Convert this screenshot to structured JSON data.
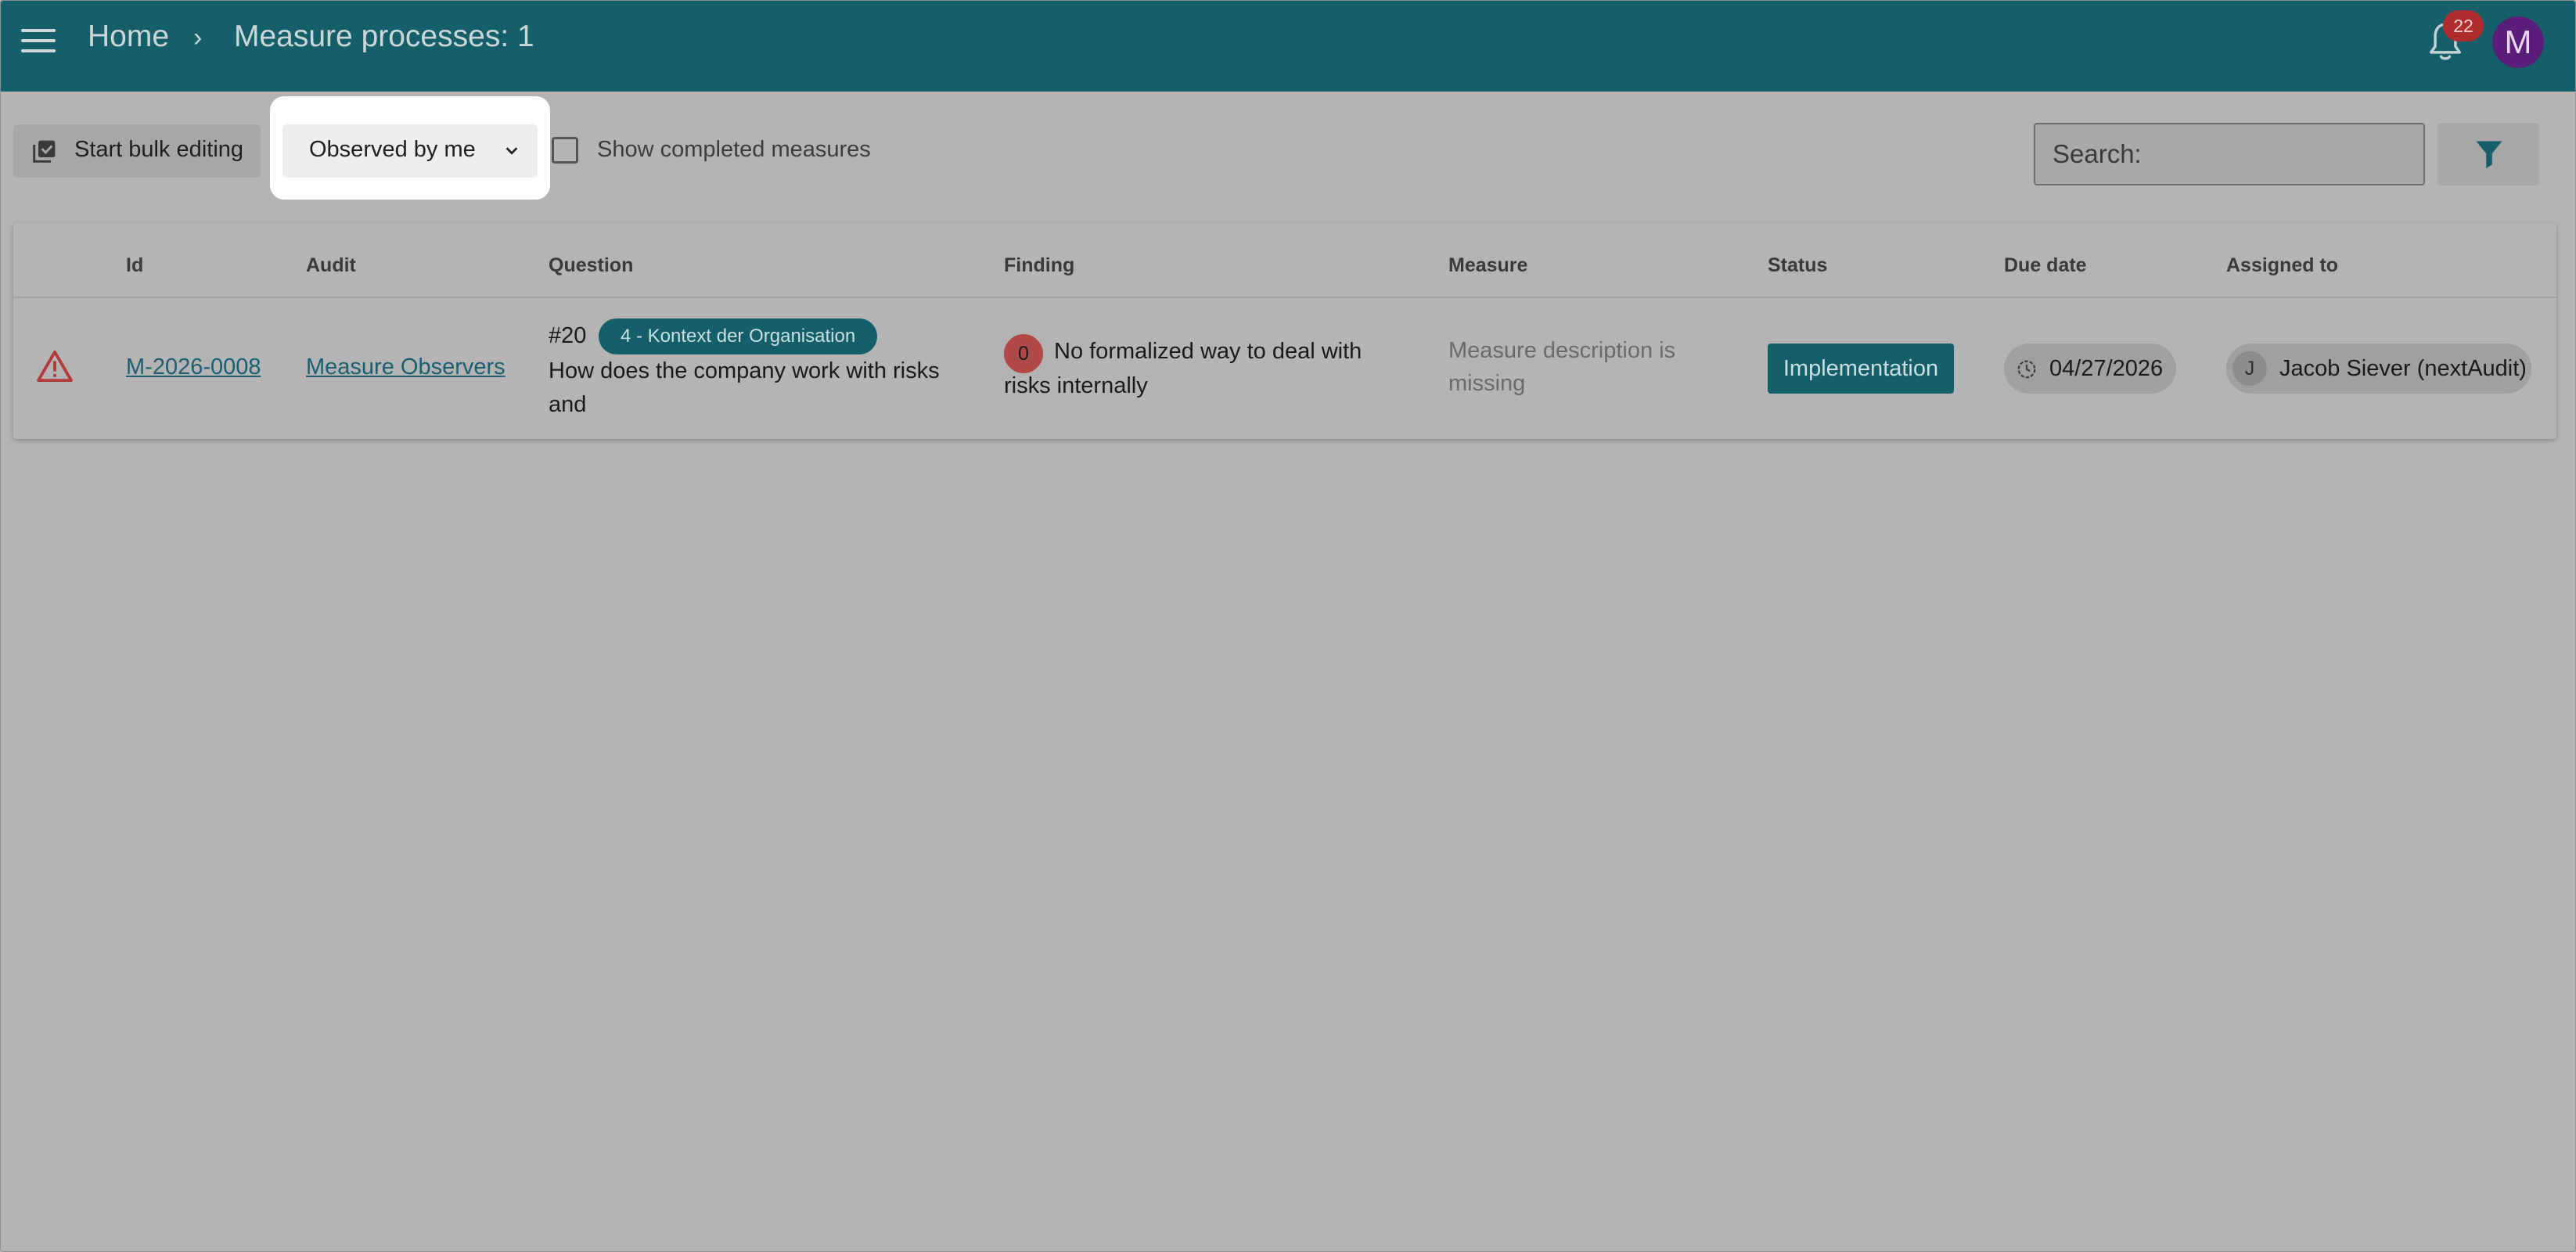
{
  "header": {
    "breadcrumb_home": "Home",
    "breadcrumb_separator": "›",
    "title": "Measure processes: 1",
    "notification_count": "22",
    "user_initial": "M",
    "bg_color": "#155f6b"
  },
  "toolbar": {
    "bulk_edit_label": "Start bulk editing",
    "filter_select_value": "Observed by me",
    "show_completed_label": "Show completed measures",
    "show_completed_checked": false,
    "search_placeholder": "Search:"
  },
  "table": {
    "headers": {
      "id": "Id",
      "audit": "Audit",
      "question": "Question",
      "finding": "Finding",
      "measure": "Measure",
      "status": "Status",
      "due_date": "Due date",
      "assigned_to": "Assigned to"
    },
    "rows": [
      {
        "icon": "warning-icon",
        "id": "M-2026-0008",
        "audit": "Measure Observers",
        "question_number": "#20",
        "question_tag": "4 - Kontext der Organisation",
        "question_text": "How does the company work with risks and",
        "finding_count": "0",
        "finding_text": "No formalized way to deal with risks internally",
        "measure_text": "Measure description is missing",
        "status": "Implementation",
        "due_date": "04/27/2026",
        "assignee_initial": "J",
        "assignee_name": "Jacob Siever (nextAudit)"
      }
    ]
  }
}
